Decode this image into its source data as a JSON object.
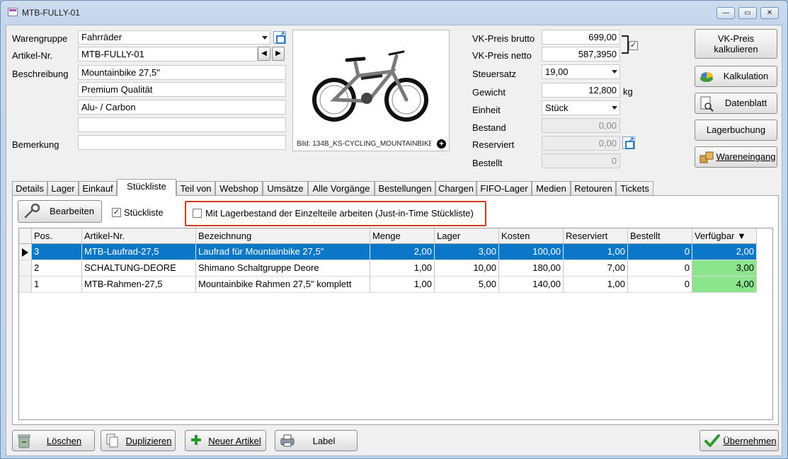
{
  "window": {
    "title": "MTB-FULLY-01",
    "min": "—",
    "max": "▭",
    "close": "✕"
  },
  "article": {
    "warengruppe_label": "Warengruppe",
    "warengruppe_value": "Fahrräder",
    "artikelnr_label": "Artikel-Nr.",
    "artikelnr_value": "MTB-FULLY-01",
    "beschreibung_label": "Beschreibung",
    "beschreibung_lines": [
      "Mountainbike 27,5\"",
      "Premium Qualität",
      "Alu- / Carbon",
      ""
    ],
    "bemerkung_label": "Bemerkung",
    "bemerkung_value": "",
    "prev": "◀",
    "next": "▶"
  },
  "image": {
    "caption": "Bild: 134B_KS-CYCLING_MOUNTAINBIKE",
    "add": "+"
  },
  "prices": {
    "vk_brutto_label": "VK-Preis brutto",
    "vk_brutto_value": "699,00",
    "vk_netto_label": "VK-Preis netto",
    "vk_netto_value": "587,3950",
    "steuersatz_label": "Steuersatz",
    "steuersatz_value": "19,00",
    "gewicht_label": "Gewicht",
    "gewicht_value": "12,800",
    "gewicht_unit": "kg",
    "einheit_label": "Einheit",
    "einheit_value": "Stück",
    "bestand_label": "Bestand",
    "bestand_value": "0,00",
    "reserviert_label": "Reserviert",
    "reserviert_value": "0,00",
    "bestellt_label": "Bestellt",
    "bestellt_value": "0",
    "link_checked": "✓"
  },
  "side_buttons": {
    "vk_calc": "VK-Preis\nkalkulieren",
    "kalkulation": "Kalkulation",
    "datenblatt": "Datenblatt",
    "lagerbuchung": "Lagerbuchung",
    "wareneingang": "Wareneingang"
  },
  "tabs": [
    "Details",
    "Lager",
    "Einkauf",
    "Stückliste",
    "Teil von",
    "Webshop",
    "Umsätze",
    "Alle Vorgänge",
    "Bestellungen",
    "Chargen",
    "FIFO-Lager",
    "Medien",
    "Retouren",
    "Tickets"
  ],
  "active_tab": "Stückliste",
  "stueckliste": {
    "bearbeiten": "Bearbeiten",
    "stueckliste_chk_label": "Stückliste",
    "stueckliste_checked": "✓",
    "jit_label": "Mit Lagerbestand der Einzelteile arbeiten (Just-in-Time Stückliste)",
    "jit_checked": "",
    "columns": [
      "Pos.",
      "Artikel-Nr.",
      "Bezeichnung",
      "Menge",
      "Lager",
      "Kosten",
      "Reserviert",
      "Bestellt",
      "Verfügbar ▼"
    ],
    "rows": [
      [
        "3",
        "MTB-Laufrad-27,5",
        "Laufrad für Mountainbike 27,5\"",
        "2,00",
        "3,00",
        "100,00",
        "1,00",
        "0",
        "2,00"
      ],
      [
        "2",
        "SCHALTUNG-DEORE",
        "Shimano Schaltgruppe Deore",
        "1,00",
        "10,00",
        "180,00",
        "7,00",
        "0",
        "3,00"
      ],
      [
        "1",
        "MTB-Rahmen-27,5",
        "Mountainbike Rahmen 27,5\" komplett",
        "1,00",
        "5,00",
        "140,00",
        "1,00",
        "0",
        "4,00"
      ]
    ]
  },
  "bottom": {
    "loeschen": "Löschen",
    "duplizieren": "Duplizieren",
    "neuer_artikel": "Neuer Artikel",
    "label": "Label",
    "uebernehmen": "Übernehmen"
  }
}
